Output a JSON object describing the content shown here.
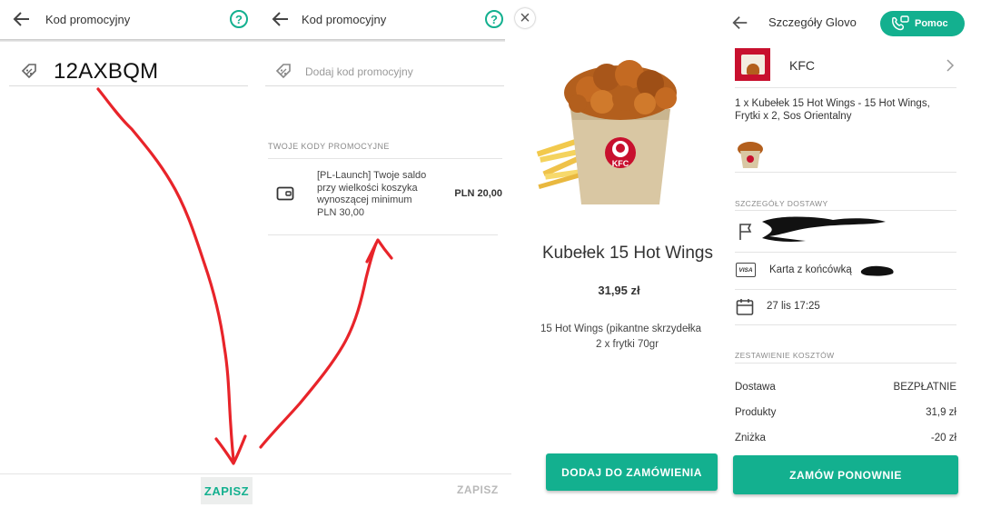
{
  "panel1": {
    "title": "Kod promocyjny",
    "help": "?",
    "code_value": "12AXBQM",
    "save_label": "ZAPISZ"
  },
  "panel2": {
    "title": "Kod promocyjny",
    "help": "?",
    "placeholder": "Dodaj kod promocyjny",
    "section_label": "TWOJE KODY PROMOCYJNE",
    "promo_text_lines": [
      "[PL-Launch] Twoje saldo",
      "przy wielkości koszyka",
      "wynoszącej minimum",
      "PLN 30,00"
    ],
    "promo_amount": "PLN 20,00",
    "save_label": "ZAPISZ"
  },
  "panel3": {
    "close": "×",
    "product_name": "Kubełek 15 Hot Wings",
    "price": "31,95 zł",
    "description_lines": [
      "15 Hot Wings (pikantne skrzydełka",
      "2 x frytki 70gr"
    ],
    "add_label": "DODAJ DO ZAMÓWIENIA"
  },
  "panel4": {
    "title": "Szczegóły Glovo",
    "help_label": "Pomoc",
    "store_name": "KFC",
    "order_lines": [
      "1 x Kubełek 15 Hot Wings -  15 Hot Wings,",
      "Frytki x 2,  Sos Orientalny"
    ],
    "delivery_section": "SZCZEGÓŁY DOSTAWY",
    "card_label": "Karta z końcówką",
    "visa": "VISA",
    "datetime": "27 lis 17:25",
    "costs_section": "ZESTAWIENIE KOSZTÓW",
    "costs": [
      {
        "label": "Dostawa",
        "value": "BEZPŁATNIE"
      },
      {
        "label": "Produkty",
        "value": "31,9 zł"
      },
      {
        "label": "Zniżka",
        "value": "-20 zł"
      }
    ],
    "reorder_label": "ZAMÓW PONOWNIE"
  },
  "colors": {
    "accent": "#13b08f",
    "arrow": "#e8242a"
  }
}
